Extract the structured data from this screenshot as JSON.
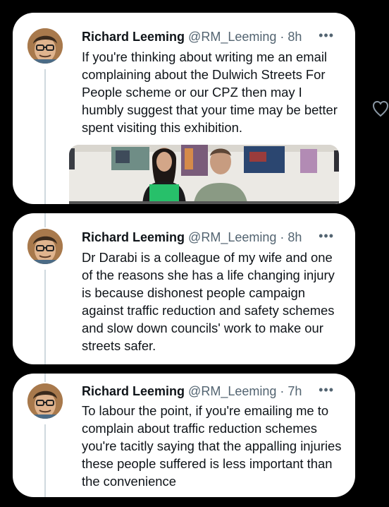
{
  "tweets": [
    {
      "name": "Richard Leeming",
      "handle": "@RM_Leeming",
      "separator": "·",
      "time": "8h",
      "more": "•••",
      "text": "If you're thinking about writing me an email complaining about the Dulwich Streets For People scheme or our CPZ then may I humbly suggest that your time may be better spent visiting this exhibition."
    },
    {
      "name": "Richard Leeming",
      "handle": "@RM_Leeming",
      "separator": "·",
      "time": "8h",
      "more": "•••",
      "text": "Dr Darabi is a colleague of my wife and one of the reasons she has a life changing injury is because dishonest people campaign against traffic  reduction and safety schemes and slow down councils' work to make our streets safer."
    },
    {
      "name": "Richard Leeming",
      "handle": "@RM_Leeming",
      "separator": "·",
      "time": "7h",
      "more": "•••",
      "text": "To labour the point, if you're emailing  me to complain about traffic reduction schemes you're tacitly saying that the appalling injuries these people suffered is less important than the convenience"
    }
  ],
  "icons": {
    "avatar": "avatar",
    "more": "more-options-icon",
    "like": "heart-icon"
  },
  "colors": {
    "background": "#000000",
    "card": "#ffffff",
    "text": "#0f1419",
    "secondary": "#536471",
    "thread_line": "#cfd9de"
  }
}
